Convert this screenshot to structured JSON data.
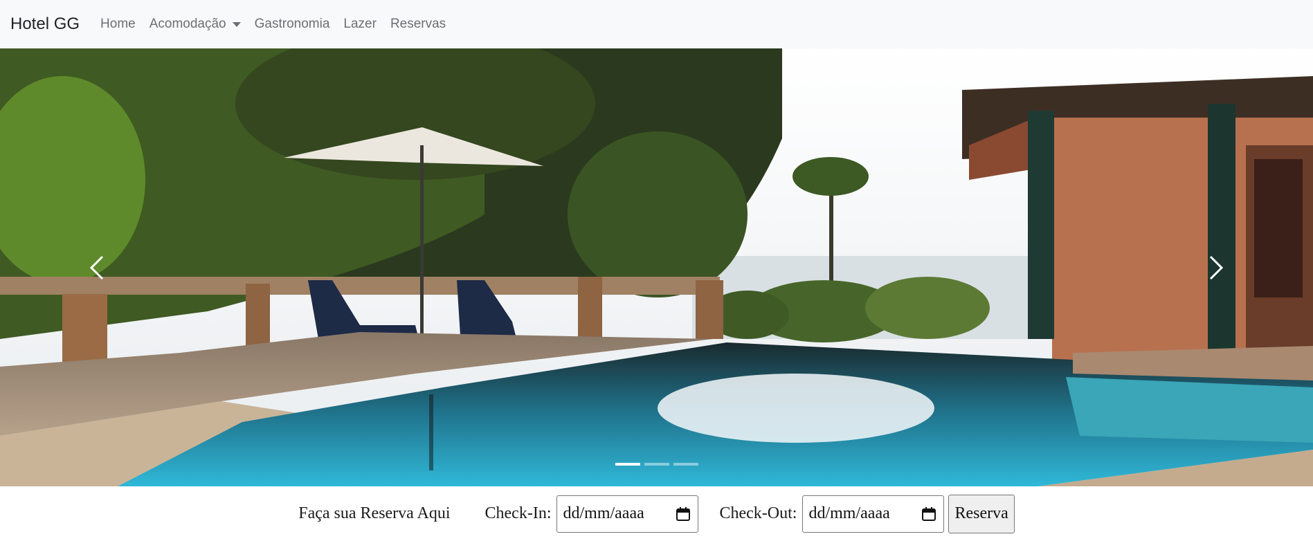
{
  "navbar": {
    "brand": "Hotel GG",
    "items": [
      {
        "label": "Home"
      },
      {
        "label": "Acomodação",
        "dropdown": true
      },
      {
        "label": "Gastronomia"
      },
      {
        "label": "Lazer"
      },
      {
        "label": "Reservas"
      }
    ]
  },
  "carousel": {
    "image": "hotel pool deck with umbrella, lounge chairs, palm trees and sea view",
    "indicators": 3,
    "active_indicator": 1,
    "prev_icon": "chevron-left-icon",
    "next_icon": "chevron-right-icon"
  },
  "booking": {
    "title": "Faça sua Reserva Aqui",
    "checkin_label": "Check-In:",
    "checkin_placeholder": "dd/mm/aaaa",
    "checkout_label": "Check-Out:",
    "checkout_placeholder": "dd/mm/aaaa",
    "submit_label": "Reserva"
  },
  "colors": {
    "navbar_bg": "#f8f9fa",
    "nav_link": "#6c6f72",
    "pool_water": "#2aa7c6"
  }
}
